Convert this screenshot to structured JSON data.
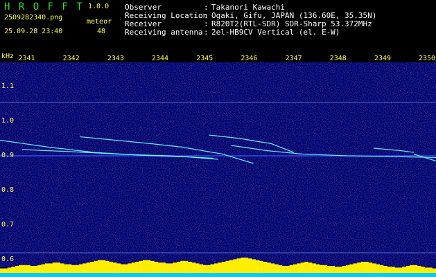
{
  "app": {
    "name": "H R O F F T",
    "version": "1.0.0"
  },
  "file": {
    "filename": "2509282340.png",
    "datetime": "25.09.28 23:40"
  },
  "counter": {
    "label": "meteor",
    "value": "48"
  },
  "station": {
    "rows": [
      {
        "key": "Observer",
        "sep": ":",
        "value": "Takanori Kawachi"
      },
      {
        "key": "Receiving Location",
        "sep": ":",
        "value": "Ogaki, Gifu, JAPAN (136.60E, 35.35N)"
      },
      {
        "key": "Receiver",
        "sep": ":",
        "value": "R820T2(RTL-SDR) SDR-Sharp 53.372MHz"
      },
      {
        "key": "Receiving antenna",
        "sep": ":",
        "value": "2el-HB9CV Vertical (el. E-W)"
      }
    ]
  },
  "colors": {
    "background": "#000066",
    "text_green": "#33dd33",
    "text_yellow": "#ffff44",
    "text_white": "#ffffff",
    "trace": "#66ffff",
    "histogram": "#ffee00",
    "histogram_base": "#00ccff"
  },
  "chart_data": {
    "type": "heatmap",
    "ylabel": "kHz",
    "x_ticks": [
      "2341",
      "2342",
      "2343",
      "2344",
      "2345",
      "2346",
      "2347",
      "2348",
      "2349",
      "2350"
    ],
    "y_ticks": [
      "1.1",
      "1.0",
      "0.9",
      "0.8",
      "0.7",
      "0.6"
    ],
    "xlim": [
      2340.4,
      2350.2
    ],
    "ylim": [
      0.58,
      1.17
    ],
    "constant_lines_khz": [
      0.9,
      1.055,
      0.62
    ],
    "traces": [
      {
        "x": [
          2340.4,
          2341.5,
          2342.5,
          2343.5,
          2344.6,
          2345.3
        ],
        "y": [
          0.945,
          0.925,
          0.91,
          0.902,
          0.897,
          0.89
        ]
      },
      {
        "x": [
          2340.9,
          2342.0,
          2343.2,
          2344.2,
          2345.2
        ],
        "y": [
          0.918,
          0.912,
          0.904,
          0.9,
          0.893
        ]
      },
      {
        "x": [
          2342.2,
          2343.0,
          2343.8,
          2344.5,
          2345.4,
          2346.1
        ],
        "y": [
          0.955,
          0.945,
          0.935,
          0.925,
          0.905,
          0.878
        ]
      },
      {
        "x": [
          2345.1,
          2345.8,
          2346.5,
          2347.0
        ],
        "y": [
          0.96,
          0.95,
          0.935,
          0.91
        ]
      },
      {
        "x": [
          2345.6,
          2346.4,
          2347.2,
          2348.2,
          2349.2,
          2350.2
        ],
        "y": [
          0.93,
          0.915,
          0.905,
          0.9,
          0.898,
          0.895
        ]
      },
      {
        "x": [
          2348.8,
          2349.4,
          2349.7
        ],
        "y": [
          0.922,
          0.915,
          0.91
        ]
      },
      {
        "x": [
          2349.7,
          2350.0,
          2350.2
        ],
        "y": [
          0.905,
          0.893,
          0.885
        ]
      }
    ],
    "activity_profile": [
      2,
      2,
      3,
      4,
      5,
      6,
      6,
      6,
      5,
      5,
      6,
      7,
      8,
      8,
      9,
      9,
      8,
      7,
      7,
      6,
      6,
      7,
      8,
      9,
      10,
      11,
      12,
      12,
      11,
      10,
      9,
      8,
      7,
      7,
      8,
      9,
      10,
      11,
      12,
      12,
      11,
      10,
      9,
      9,
      8,
      8,
      9,
      10,
      11,
      11,
      10,
      9,
      8,
      7,
      6,
      6,
      7,
      8,
      9,
      10,
      11,
      12,
      13,
      14,
      15,
      15,
      14,
      13,
      12,
      11,
      10,
      9,
      8,
      7,
      6,
      5,
      5,
      6,
      7,
      8,
      9,
      10,
      9,
      8,
      7,
      6,
      6,
      5,
      5,
      4,
      4,
      5,
      6,
      7,
      8,
      9,
      10,
      10,
      9,
      8,
      7,
      6,
      5,
      4,
      4,
      3,
      3,
      4,
      5,
      6,
      6,
      5,
      4,
      3,
      3,
      2
    ]
  }
}
